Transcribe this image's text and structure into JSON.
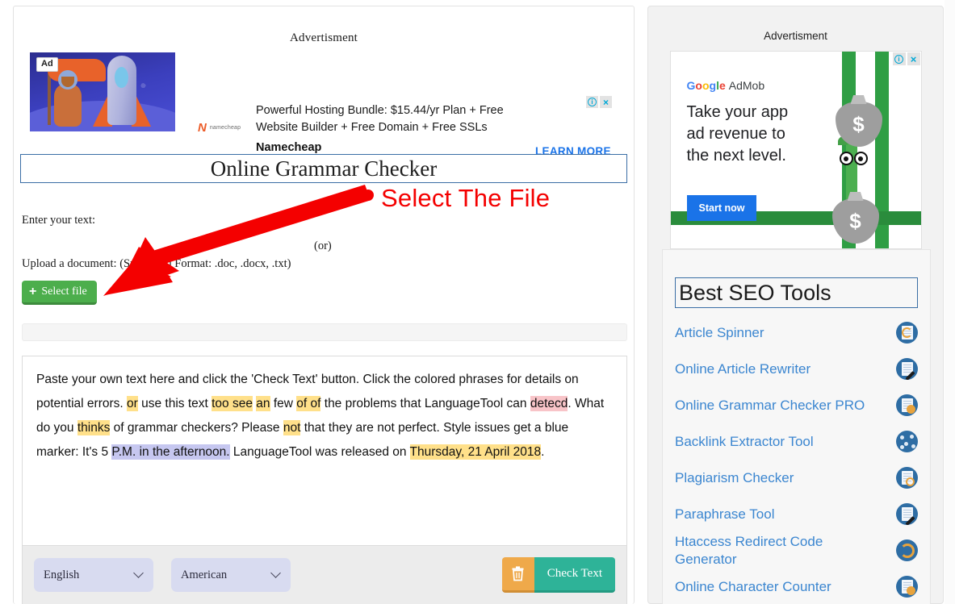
{
  "main": {
    "top_ad": {
      "label": "Advertisment",
      "badge": "Ad",
      "headline_line1": "Powerful Hosting Bundle: $15.44/yr Plan + Free",
      "headline_line2": "Website Builder + Free Domain + Free SSLs",
      "brand": "Namecheap",
      "advertiser_logo_mark": "N",
      "advertiser_logo_word": "namecheap",
      "cta": "LEARN MORE",
      "info_icon": "i",
      "close_icon": "×"
    },
    "page_title": "Online Grammar Checker",
    "labels": {
      "enter_text": "Enter your text:",
      "or": "(or)",
      "upload": "Upload a document: (Supported Format: .doc, .docx, .txt)"
    },
    "select_file_button": {
      "plus": "+",
      "label": "Select file"
    },
    "editor": {
      "segments": [
        {
          "text": "Paste your own text here and click the 'Check Text' button. Click the colored phrases for details on potential errors. ",
          "mark": ""
        },
        {
          "text": "or",
          "mark": "err-grammar"
        },
        {
          "text": " use this text ",
          "mark": ""
        },
        {
          "text": "too see",
          "mark": "err-grammar"
        },
        {
          "text": " ",
          "mark": ""
        },
        {
          "text": "an",
          "mark": "err-grammar"
        },
        {
          "text": " few ",
          "mark": ""
        },
        {
          "text": "of of",
          "mark": "err-grammar"
        },
        {
          "text": " the problems that LanguageTool can ",
          "mark": ""
        },
        {
          "text": "detecd",
          "mark": "err-spell"
        },
        {
          "text": ". What do you ",
          "mark": ""
        },
        {
          "text": "thinks",
          "mark": "err-grammar"
        },
        {
          "text": " of grammar checkers? Please ",
          "mark": ""
        },
        {
          "text": "not",
          "mark": "err-grammar"
        },
        {
          "text": " that they are not perfect. Style issues get a blue marker: It's 5 ",
          "mark": ""
        },
        {
          "text": "P.M. in the afternoon.",
          "mark": "err-style"
        },
        {
          "text": " LanguageTool was released on ",
          "mark": ""
        },
        {
          "text": "Thursday, 21 April 2018",
          "mark": "err-grammar"
        },
        {
          "text": ".",
          "mark": ""
        }
      ]
    },
    "toolbar": {
      "language_value": "English",
      "variant_value": "American",
      "clear_label": "trash-icon",
      "check_label": "Check Text"
    }
  },
  "annotation": {
    "text": "Select The File",
    "color": "#f40000"
  },
  "sidebar": {
    "ad_label": "Advertisment",
    "admob": {
      "brand_google": [
        "G",
        "o",
        "o",
        "g",
        "l",
        "e"
      ],
      "brand_product": "AdMob",
      "headline": "Take your app ad revenue to the next level.",
      "cta": "Start now",
      "money_symbol": "$",
      "info_icon": "i",
      "close_icon": "×"
    },
    "seo": {
      "title": "Best SEO Tools",
      "items": [
        {
          "label": "Article Spinner",
          "icon": "article-spinner-icon"
        },
        {
          "label": "Online Article Rewriter",
          "icon": "article-rewriter-icon"
        },
        {
          "label": "Online Grammar Checker PRO",
          "icon": "grammar-checker-pro-icon"
        },
        {
          "label": "Backlink Extractor Tool",
          "icon": "backlink-extractor-icon"
        },
        {
          "label": "Plagiarism Checker",
          "icon": "plagiarism-checker-icon"
        },
        {
          "label": "Paraphrase Tool",
          "icon": "paraphrase-tool-icon"
        },
        {
          "label": "Htaccess Redirect Code Generator",
          "icon": "htaccess-redirect-icon"
        },
        {
          "label": "Online Character Counter",
          "icon": "character-counter-icon"
        }
      ]
    }
  },
  "colors": {
    "accent_blue": "#3a6ea5",
    "link_blue": "#3b86d0",
    "green_button": "#4cae4c",
    "teal_button": "#2eb398",
    "orange_button": "#efa94a",
    "grammar_highlight": "#ffe08a",
    "spelling_highlight": "#f8c4c8",
    "style_highlight": "#c6c7f0"
  }
}
